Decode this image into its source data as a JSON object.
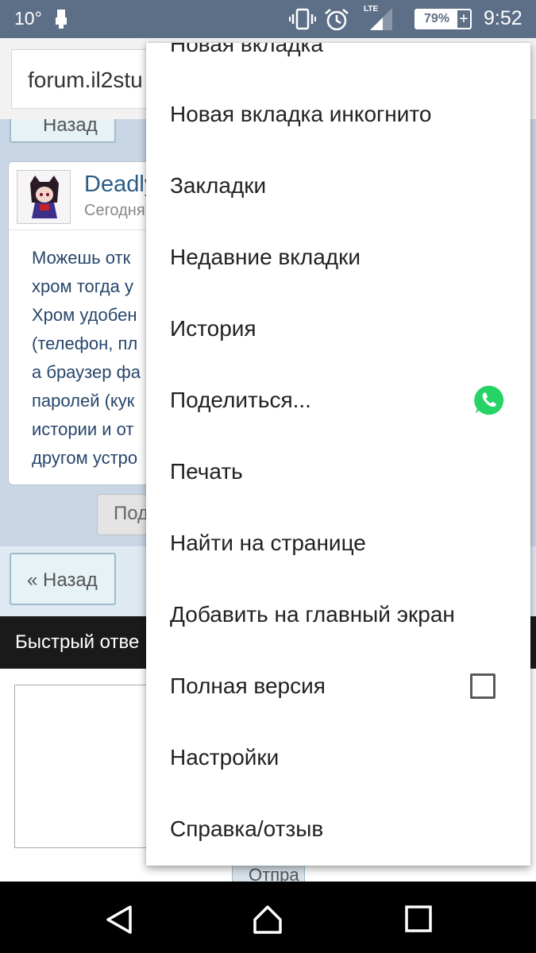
{
  "status_bar": {
    "temperature": "10°",
    "network": "LTE",
    "battery": "79%",
    "battery_plus": "+",
    "time": "9:52"
  },
  "address_bar": {
    "url": "forum.il2stu"
  },
  "page": {
    "back_button_top": "Назад",
    "post": {
      "author": "Deadly",
      "posted": "Сегодня",
      "body_lines": [
        "Можешь отк",
        "хром тогда у",
        "Хром удобен",
        "(телефон, пл",
        "а браузер фа",
        "паролей (кук",
        "истории и от",
        "другом устро"
      ]
    },
    "reply_button": "Под",
    "back_button": "« Назад",
    "quick_reply": "Быстрый отве",
    "send_button": "Отпра"
  },
  "menu": {
    "partial_item": "Новая вкладка",
    "items": [
      {
        "label": "Новая вкладка инкогнито"
      },
      {
        "label": "Закладки"
      },
      {
        "label": "Недавние вкладки"
      },
      {
        "label": "История"
      },
      {
        "label": "Поделиться...",
        "icon": "whatsapp-icon",
        "icon_color": "#25d366"
      },
      {
        "label": "Печать"
      },
      {
        "label": "Найти на странице"
      },
      {
        "label": "Добавить на главный экран"
      },
      {
        "label": "Полная версия",
        "checked": false
      },
      {
        "label": "Настройки"
      },
      {
        "label": "Справка/отзыв"
      }
    ]
  },
  "colors": {
    "status_bar": "#5d6f87",
    "menu_bg": "#ffffff",
    "link": "#2b5c85"
  }
}
